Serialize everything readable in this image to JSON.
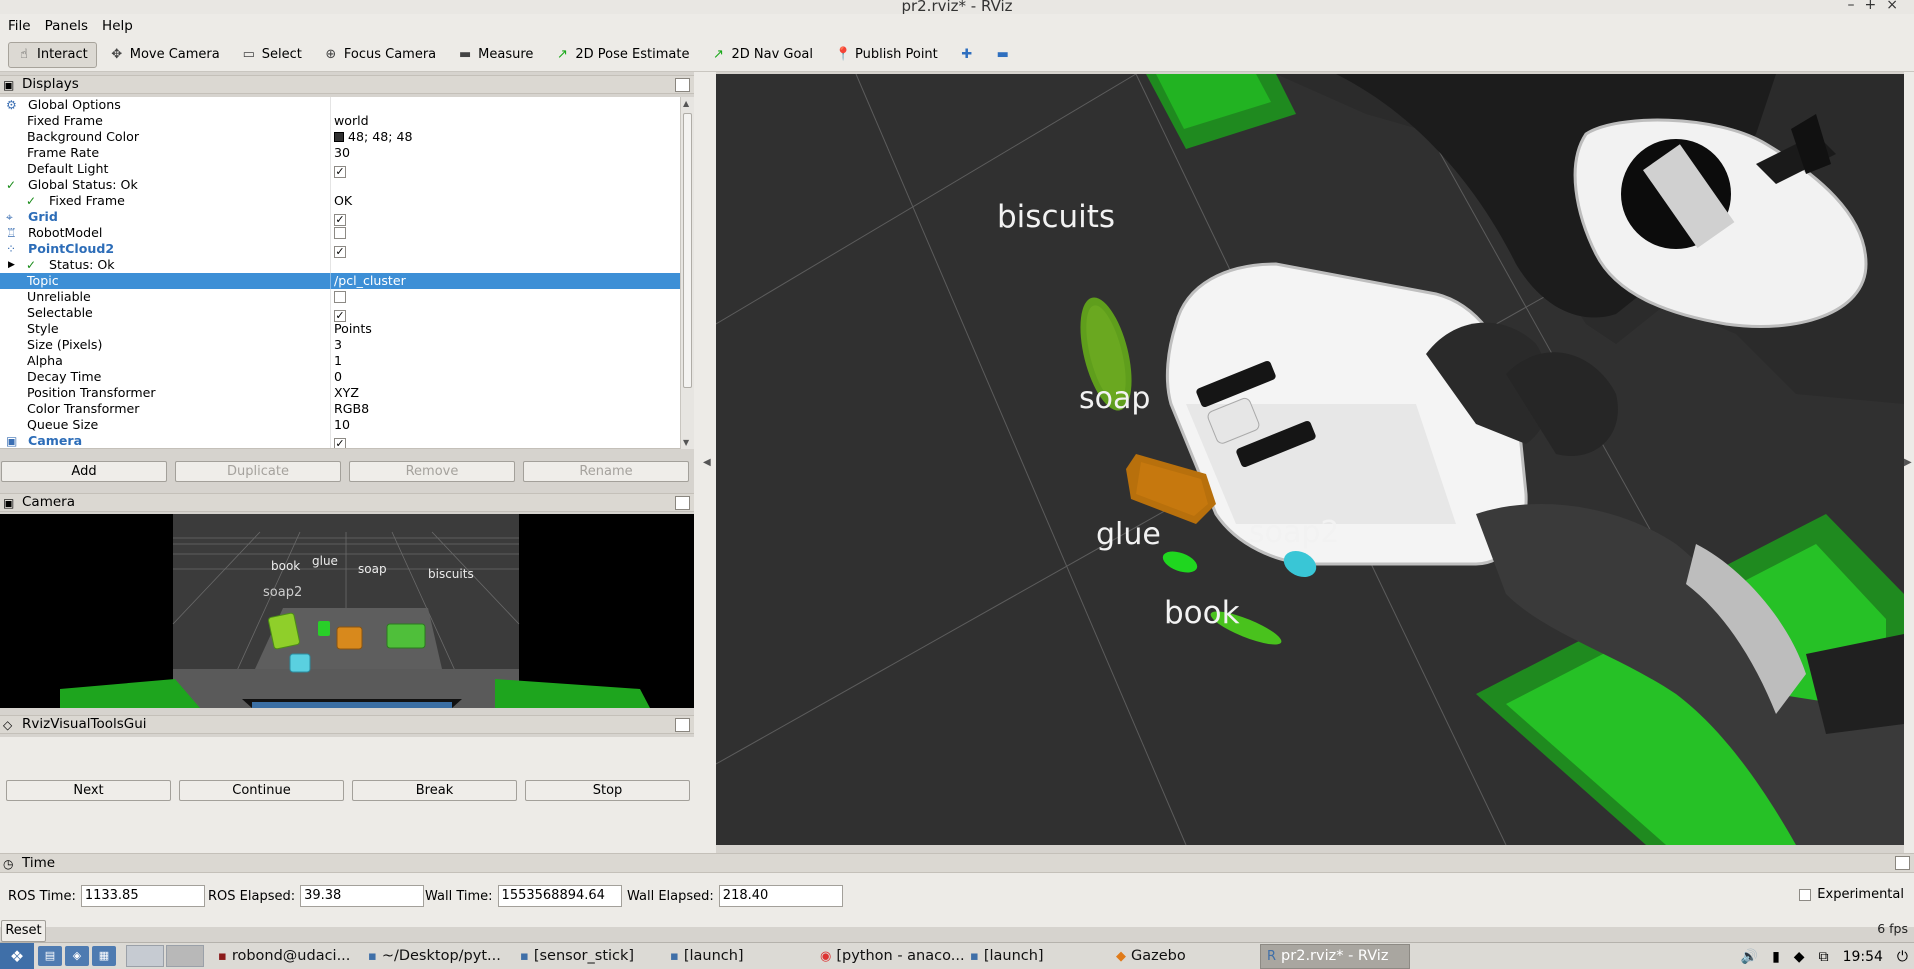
{
  "window": {
    "title": "pr2.rviz* - RViz",
    "controls": [
      "–",
      "+",
      "×"
    ]
  },
  "menu": [
    "File",
    "Panels",
    "Help"
  ],
  "toolbar": [
    {
      "label": "Interact",
      "icon": "hand-icon",
      "glyph": "☝",
      "active": true
    },
    {
      "label": "Move Camera",
      "icon": "move-camera-icon",
      "glyph": "✥",
      "active": false
    },
    {
      "label": "Select",
      "icon": "select-icon",
      "glyph": "▭",
      "active": false
    },
    {
      "label": "Focus Camera",
      "icon": "focus-camera-icon",
      "glyph": "⊕",
      "active": false
    },
    {
      "label": "Measure",
      "icon": "measure-icon",
      "glyph": "▬",
      "active": false
    },
    {
      "label": "2D Pose Estimate",
      "icon": "pose-estimate-icon",
      "glyph": "↗",
      "active": false
    },
    {
      "label": "2D Nav Goal",
      "icon": "nav-goal-icon",
      "glyph": "↗",
      "active": false
    },
    {
      "label": "Publish Point",
      "icon": "publish-point-icon",
      "glyph": "📍",
      "active": false
    },
    {
      "label": "",
      "icon": "add-tool-icon",
      "glyph": "✚",
      "active": false
    },
    {
      "label": "",
      "icon": "remove-tool-icon",
      "glyph": "▬",
      "active": false
    }
  ],
  "displays": {
    "title": "Displays",
    "rows": [
      {
        "key": "Global Options",
        "value": "",
        "indent": 1,
        "icon": "gear-icon",
        "glyph": "⚙",
        "bold": false
      },
      {
        "key": "Fixed Frame",
        "value": "world",
        "indent": 2,
        "bold": false
      },
      {
        "key": "Background Color",
        "value": "48; 48; 48",
        "indent": 2,
        "swatch": true,
        "bold": false
      },
      {
        "key": "Frame Rate",
        "value": "30",
        "indent": 2,
        "bold": false
      },
      {
        "key": "Default Light",
        "value": "",
        "indent": 2,
        "check": "on",
        "bold": false
      },
      {
        "key": "Global Status: Ok",
        "value": "",
        "indent": 1,
        "icon": "check-icon",
        "glyph": "✓",
        "bold": false
      },
      {
        "key": "Fixed Frame",
        "value": "OK",
        "indent": 2,
        "icon": "check-icon",
        "glyph": "✓",
        "bold": false
      },
      {
        "key": "Grid",
        "value": "",
        "indent": 1,
        "icon": "grid-icon",
        "glyph": "⌖",
        "check": "on",
        "bold": true
      },
      {
        "key": "RobotModel",
        "value": "",
        "indent": 1,
        "icon": "robot-icon",
        "glyph": "♖",
        "check": "off",
        "bold": false
      },
      {
        "key": "PointCloud2",
        "value": "",
        "indent": 1,
        "icon": "pointcloud-icon",
        "glyph": "⁘",
        "check": "on",
        "bold": true
      },
      {
        "key": "Status: Ok",
        "value": "",
        "indent": 2,
        "icon": "check-icon",
        "glyph": "✓",
        "expander": true,
        "bold": false
      },
      {
        "key": "Topic",
        "value": "/pcl_cluster",
        "indent": 2,
        "selected": true,
        "bold": false
      },
      {
        "key": "Unreliable",
        "value": "",
        "indent": 2,
        "check": "off",
        "bold": false
      },
      {
        "key": "Selectable",
        "value": "",
        "indent": 2,
        "check": "on",
        "bold": false
      },
      {
        "key": "Style",
        "value": "Points",
        "indent": 2,
        "bold": false
      },
      {
        "key": "Size (Pixels)",
        "value": "3",
        "indent": 2,
        "bold": false
      },
      {
        "key": "Alpha",
        "value": "1",
        "indent": 2,
        "bold": false
      },
      {
        "key": "Decay Time",
        "value": "0",
        "indent": 2,
        "bold": false
      },
      {
        "key": "Position Transformer",
        "value": "XYZ",
        "indent": 2,
        "bold": false
      },
      {
        "key": "Color Transformer",
        "value": "RGB8",
        "indent": 2,
        "bold": false
      },
      {
        "key": "Queue Size",
        "value": "10",
        "indent": 2,
        "bold": false
      },
      {
        "key": "Camera",
        "value": "",
        "indent": 1,
        "icon": "camera-icon",
        "glyph": "▣",
        "check": "on",
        "bold": true
      }
    ],
    "buttons": [
      {
        "label": "Add",
        "enabled": true
      },
      {
        "label": "Duplicate",
        "enabled": false
      },
      {
        "label": "Remove",
        "enabled": false
      },
      {
        "label": "Rename",
        "enabled": false
      }
    ]
  },
  "camera_panel": {
    "title": "Camera",
    "labels": [
      "book",
      "glue",
      "soap",
      "biscuits",
      "soap2"
    ]
  },
  "rviz_visual_tools": {
    "title": "RvizVisualToolsGui",
    "buttons": [
      "Next",
      "Continue",
      "Break",
      "Stop"
    ]
  },
  "view3d": {
    "background": "#303030",
    "labels": [
      "biscuits",
      "soap",
      "glue",
      "soap2",
      "book"
    ],
    "cluster_colors": {
      "biscuits": "#6aa820",
      "soap": "#c6780e",
      "glue": "#1fd61f",
      "soap2": "#39c6d6",
      "book": "#49c21d"
    }
  },
  "time_panel": {
    "title": "Time",
    "fields": [
      {
        "label": "ROS Time:",
        "value": "1133.85"
      },
      {
        "label": "ROS Elapsed:",
        "value": "39.38"
      },
      {
        "label": "Wall Time:",
        "value": "1553568894.64"
      },
      {
        "label": "Wall Elapsed:",
        "value": "218.40"
      }
    ],
    "experimental_label": "Experimental",
    "reset_label": "Reset",
    "fps": "6 fps"
  },
  "taskbar": {
    "tasks": [
      {
        "label": "robond@udaci...",
        "icon": "terminal-icon",
        "glyph": "▪",
        "active": false
      },
      {
        "label": "~/Desktop/pyt...",
        "icon": "folder-icon",
        "glyph": "▪",
        "active": false
      },
      {
        "label": "[sensor_stick]",
        "icon": "folder-icon",
        "glyph": "▪",
        "active": false
      },
      {
        "label": "[launch]",
        "icon": "folder-icon",
        "glyph": "▪",
        "active": false
      },
      {
        "label": "[python - anaco...",
        "icon": "chrome-icon",
        "glyph": "◉",
        "active": false
      },
      {
        "label": "[launch]",
        "icon": "folder-icon",
        "glyph": "▪",
        "active": false
      },
      {
        "label": "Gazebo",
        "icon": "gazebo-icon",
        "glyph": "◆",
        "active": false
      },
      {
        "label": "pr2.rviz* - RViz",
        "icon": "rviz-icon",
        "glyph": "R",
        "active": true
      }
    ],
    "clock": "19:54"
  }
}
